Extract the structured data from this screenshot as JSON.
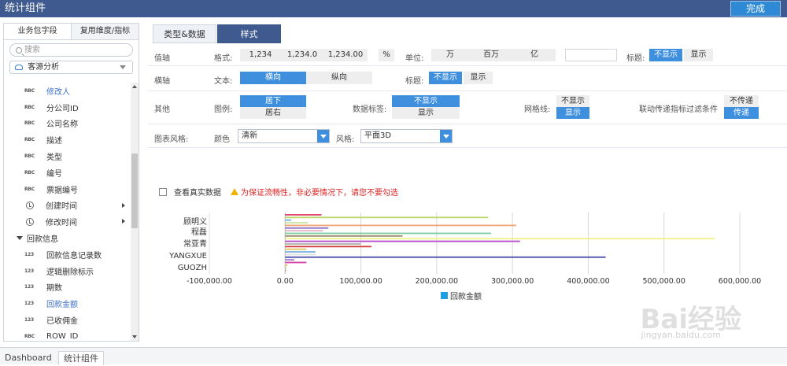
{
  "app": {
    "title": "统计组件",
    "done_label": "完成"
  },
  "left_panel": {
    "tabs": [
      "业务包字段",
      "复用维度/指标"
    ],
    "search_placeholder": "搜索",
    "datasource": "客源分析",
    "fields": [
      {
        "type": "RBC",
        "name": "修改人",
        "selected": true
      },
      {
        "type": "RBC",
        "name": "分公司ID"
      },
      {
        "type": "RBC",
        "name": "公司名称"
      },
      {
        "type": "RBC",
        "name": "描述"
      },
      {
        "type": "RBC",
        "name": "类型"
      },
      {
        "type": "RBC",
        "name": "编号"
      },
      {
        "type": "RBC",
        "name": "票据编号"
      },
      {
        "type": "clock",
        "name": "创建时间",
        "expandable": true
      },
      {
        "type": "clock",
        "name": "修改时间",
        "expandable": true
      }
    ],
    "group": {
      "name": "回款信息",
      "fields": [
        {
          "type": "123",
          "name": "回款信息记录数"
        },
        {
          "type": "123",
          "name": "逻辑删除标示"
        },
        {
          "type": "123",
          "name": "期数"
        },
        {
          "type": "123",
          "name": "回款金额",
          "selected": true
        },
        {
          "type": "123",
          "name": "已收佣金"
        },
        {
          "type": "RBC",
          "name": "ROW_ID"
        }
      ]
    }
  },
  "right_tabs": [
    "类型&数据",
    "样式"
  ],
  "settings": {
    "value_axis": {
      "label": "值轴",
      "format_label": "格式:",
      "formats": [
        "1,234",
        "1,234.0",
        "1,234.00",
        "%"
      ],
      "unit_label": "单位:",
      "units": [
        "万",
        "百万",
        "亿"
      ],
      "title_label": "标题:",
      "title_opts": [
        "不显示",
        "显示"
      ]
    },
    "category_axis": {
      "label": "横轴",
      "text_label": "文本:",
      "text_opts": [
        "横向",
        "纵向"
      ],
      "title_label": "标题:",
      "title_opts": [
        "不显示",
        "显示"
      ]
    },
    "other": {
      "label": "其他",
      "legend_label": "图例:",
      "legend_opts": [
        "居下",
        "居右"
      ],
      "data_label_label": "数据标签:",
      "data_label_opts": [
        "不显示",
        "显示"
      ],
      "grid_label": "网格线:",
      "grid_opts": [
        "不显示",
        "显示"
      ],
      "linkage_label": "联动传递指标过滤条件",
      "linkage_opts": [
        "不传递",
        "传递"
      ]
    },
    "style": {
      "label": "图表风格:",
      "color_label": "颜色",
      "color_value": "清新",
      "style_label": "风格:",
      "style_value": "平面3D"
    }
  },
  "chart_panel": {
    "real_data_label": "查看真实数据",
    "warning": "为保证流畅性，非必要情况下，请您不要勾选"
  },
  "chart_data": {
    "type": "bar",
    "orientation": "horizontal",
    "categories": [
      "顾明义",
      "程磊",
      "常亚青",
      "YANGXUE",
      "GUOZH"
    ],
    "xlim": [
      -100000,
      600000
    ],
    "xticks": [
      "-100,000.00",
      "0.00",
      "100,000.00",
      "200,000.00",
      "300,000.00",
      "400,000.00",
      "500,000.00",
      "600,000.00"
    ],
    "grid": true,
    "legend_position": "bottom",
    "series": [
      {
        "name": "回款金额"
      }
    ],
    "bars": [
      {
        "value": 48000,
        "color": "#e04a6f"
      },
      {
        "value": 268000,
        "color": "#bcd66a"
      },
      {
        "value": 8000,
        "color": "#6fb6e8"
      },
      {
        "value": 30000,
        "color": "#c9e6a5"
      },
      {
        "value": 305000,
        "color": "#f0a878"
      },
      {
        "value": 57000,
        "color": "#8a6fc4"
      },
      {
        "value": 50000,
        "color": "#e8b4c4"
      },
      {
        "value": 272000,
        "color": "#7ccfa2"
      },
      {
        "value": 155000,
        "color": "#9a8d6d"
      },
      {
        "value": 567000,
        "color": "#f2f28a"
      },
      {
        "value": 310000,
        "color": "#b54fc9"
      },
      {
        "value": 100000,
        "color": "#b0b0b0"
      },
      {
        "value": 114000,
        "color": "#d13c3c"
      },
      {
        "value": 28000,
        "color": "#e3c36a"
      },
      {
        "value": 40000,
        "color": "#7bb3e0"
      },
      {
        "value": 40000,
        "color": "#e0e0e0"
      },
      {
        "value": 423000,
        "color": "#4a4fa8"
      },
      {
        "value": 12000,
        "color": "#9d7cd0"
      },
      {
        "value": 28000,
        "color": "#d048a8"
      },
      {
        "value": 3000,
        "color": "#f0b060"
      },
      {
        "value": 1500,
        "color": "#a0d090"
      },
      {
        "value": 800,
        "color": "#e06060"
      }
    ],
    "colors": {
      "accent": "#3e8fde",
      "legend": "#1ea0e0"
    }
  },
  "bottom_tabs": [
    "Dashboard",
    "统计组件"
  ],
  "watermark": {
    "main": "Bai经验",
    "sub": "jingyan.baidu.com"
  }
}
